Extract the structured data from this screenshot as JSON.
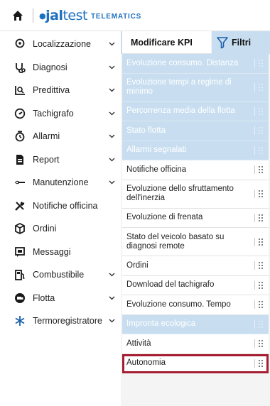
{
  "brand": {
    "logo_prefix": "●",
    "logo_main": "jal",
    "logo_thin": "test",
    "subtitle": "TELEMATICS"
  },
  "sidebar": {
    "items": [
      {
        "label": "Localizzazione",
        "icon": "location-pin-icon",
        "has_chevron": true
      },
      {
        "label": "Diagnosi",
        "icon": "stethoscope-icon",
        "has_chevron": true
      },
      {
        "label": "Predittiva",
        "icon": "predictive-chart-icon",
        "has_chevron": true
      },
      {
        "label": "Tachigrafo",
        "icon": "tachograph-icon",
        "has_chevron": true
      },
      {
        "label": "Allarmi",
        "icon": "alarm-clock-icon",
        "has_chevron": true
      },
      {
        "label": "Report",
        "icon": "report-document-icon",
        "has_chevron": true
      },
      {
        "label": "Manutenzione",
        "icon": "maintenance-icon",
        "has_chevron": true
      },
      {
        "label": "Notifiche officina",
        "icon": "workshop-tools-icon",
        "has_chevron": false
      },
      {
        "label": "Ordini",
        "icon": "orders-box-icon",
        "has_chevron": false
      },
      {
        "label": "Messaggi",
        "icon": "messages-icon",
        "has_chevron": false
      },
      {
        "label": "Combustibile",
        "icon": "fuel-pump-icon",
        "has_chevron": true
      },
      {
        "label": "Flotta",
        "icon": "fleet-truck-icon",
        "has_chevron": true
      },
      {
        "label": "Termoregistratore",
        "icon": "snowflake-icon",
        "has_chevron": true
      }
    ]
  },
  "panel": {
    "modify_kpi_label": "Modificare KPI",
    "filters_label": "Filtri",
    "kpis": [
      {
        "label": "Evoluzione consumo. Distanza",
        "disabled": true,
        "lines": 1
      },
      {
        "label": "Evoluzione tempi a regime di minimo",
        "disabled": true,
        "lines": 2
      },
      {
        "label": "Percorrenza media della flotta",
        "disabled": true,
        "lines": 1
      },
      {
        "label": "Stato flotta",
        "disabled": true,
        "lines": 1
      },
      {
        "label": "Allarmi segnalati",
        "disabled": true,
        "lines": 1
      },
      {
        "label": "Notifiche officina",
        "disabled": false,
        "lines": 1
      },
      {
        "label": "Evoluzione dello sfruttamento dell'inerzia",
        "disabled": false,
        "lines": 2
      },
      {
        "label": "Evoluzione di frenata",
        "disabled": false,
        "lines": 1
      },
      {
        "label": "Stato del veicolo basato su diagnosi remote",
        "disabled": false,
        "lines": 2
      },
      {
        "label": "Ordini",
        "disabled": false,
        "lines": 1
      },
      {
        "label": "Download del tachigrafo",
        "disabled": false,
        "lines": 1
      },
      {
        "label": "Evoluzione consumo. Tempo",
        "disabled": false,
        "lines": 1
      },
      {
        "label": "Impronta ecologica",
        "disabled": true,
        "lines": 1
      },
      {
        "label": "Attività",
        "disabled": false,
        "lines": 1
      },
      {
        "label": "Autonomia",
        "disabled": false,
        "lines": 1,
        "selected": true
      }
    ]
  },
  "colors": {
    "accent": "#1d6fbf",
    "panel_header": "#c8def0",
    "disabled_row": "#c8def0",
    "selection": "#a61d32"
  }
}
